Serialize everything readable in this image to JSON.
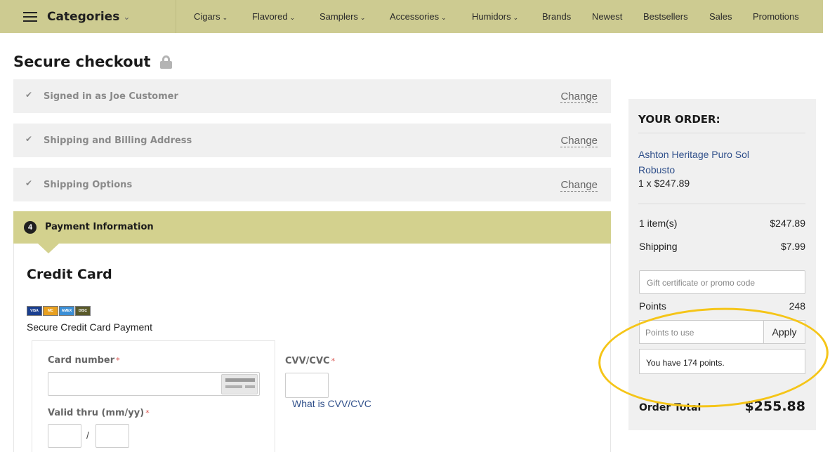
{
  "nav": {
    "categories_label": "Categories",
    "items": [
      {
        "label": "Cigars",
        "has_dropdown": true
      },
      {
        "label": "Flavored",
        "has_dropdown": true
      },
      {
        "label": "Samplers",
        "has_dropdown": true
      },
      {
        "label": "Accessories",
        "has_dropdown": true
      },
      {
        "label": "Humidors",
        "has_dropdown": true
      },
      {
        "label": "Brands",
        "has_dropdown": false
      },
      {
        "label": "Newest",
        "has_dropdown": false
      },
      {
        "label": "Bestsellers",
        "has_dropdown": false
      },
      {
        "label": "Sales",
        "has_dropdown": false
      },
      {
        "label": "Promotions",
        "has_dropdown": false
      }
    ],
    "chevron": "⌄"
  },
  "page": {
    "title": "Secure checkout",
    "title_icon": "lock-icon"
  },
  "steps": [
    {
      "label": "Signed in as Joe Customer",
      "change": "Change",
      "check": "✔"
    },
    {
      "label": "Shipping and Billing Address",
      "change": "Change",
      "check": "✔"
    },
    {
      "label": "Shipping Options",
      "change": "Change",
      "check": "✔"
    }
  ],
  "payment": {
    "step_number": "4",
    "header": "Payment Information",
    "section_title": "Credit Card",
    "card_brands": [
      "VISA",
      "MC",
      "AMEX",
      "DISC"
    ],
    "secure_text": "Secure Credit Card Payment",
    "card_number_label": "Card number",
    "valid_thru_label": "Valid thru (mm/yy)",
    "cvv_label": "CVV/CVC",
    "cvv_link": "What is CVV/CVC",
    "required_mark": "*",
    "date_separator": "/"
  },
  "order": {
    "title": "YOUR ORDER:",
    "product_name": "Ashton Heritage Puro Sol Robusto",
    "product_qty": "1 x $247.89",
    "items_label": "1 item(s)",
    "items_value": "$247.89",
    "shipping_label": "Shipping",
    "shipping_value": "$7.99",
    "promo_placeholder": "Gift certificate or promo code",
    "points_label": "Points",
    "points_value": "248",
    "points_placeholder": "Points to use",
    "apply_label": "Apply",
    "points_note": "You have 174 points.",
    "total_label": "Order Total",
    "total_value": "$255.88"
  },
  "colors": {
    "nav_bg": "#cdcb91",
    "active_step": "#d3d18e",
    "highlight": "#f5c518",
    "link": "#2f4f8a"
  }
}
